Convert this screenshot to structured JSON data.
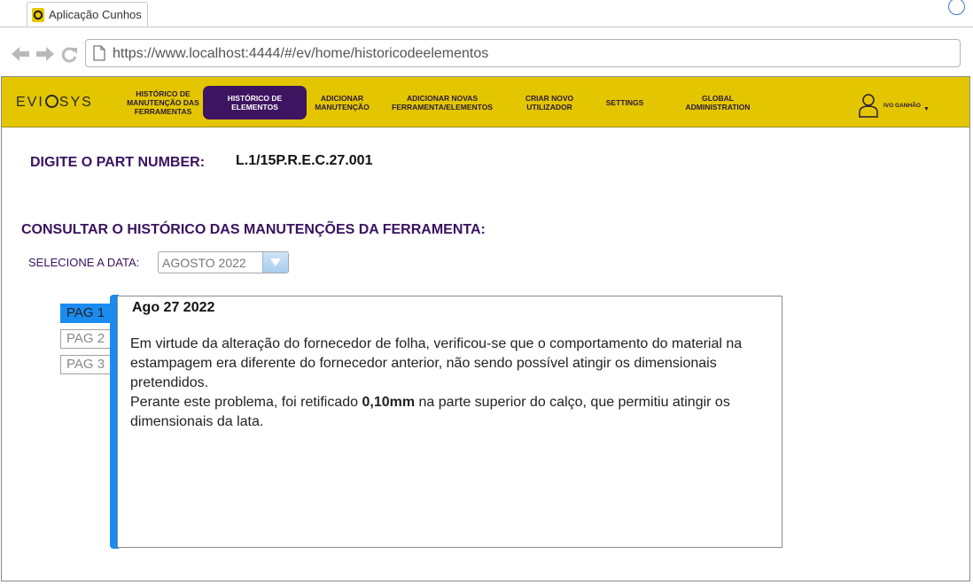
{
  "browser": {
    "tab_title": "Aplicação Cunhos",
    "url": "https://www.localhost:4444/#/ev/home/historicodeelementos"
  },
  "header": {
    "logo": {
      "prefix": "EVI",
      "suffix": "SYS"
    },
    "menu": [
      {
        "lines": [
          "HISTÓRICO DE",
          "MANUTENÇÃO DAS",
          "FERRAMENTAS"
        ],
        "active": false
      },
      {
        "lines": [
          "HISTÓRICO DE",
          "ELEMENTOS"
        ],
        "active": true
      },
      {
        "lines": [
          "ADICIONAR",
          "MANUTENÇÃO"
        ],
        "active": false
      },
      {
        "lines": [
          "ADICIONAR NOVAS",
          "FERRAMENTA/ELEMENTOS"
        ],
        "active": false
      },
      {
        "lines": [
          "CRIAR NOVO",
          "UTILIZADOR"
        ],
        "active": false
      },
      {
        "lines": [
          "SETTINGS"
        ],
        "active": false
      },
      {
        "lines": [
          "GLOBAL",
          "ADMINISTRATION"
        ],
        "active": false
      }
    ],
    "user_name": "IVO GANHÃO"
  },
  "part_number": {
    "label": "DIGITE O PART NUMBER:",
    "value": "L.1/15P.R.E.C.27.001"
  },
  "history": {
    "title": "CONSULTAR O HISTÓRICO DAS MANUTENÇÕES  DA FERRAMENTA:",
    "date_label": "SELECIONE A DATA:",
    "date_selected": "AGOSTO 2022",
    "pages": [
      {
        "label": "PAG 1",
        "active": true
      },
      {
        "label": "PAG 2",
        "active": false
      },
      {
        "label": "PAG 3",
        "active": false
      }
    ],
    "note": {
      "date": "Ago 27 2022",
      "paragraph1": "Em virtude da alteração do fornecedor de folha, verificou-se que o comportamento do material na estampagem era diferente do fornecedor anterior, não sendo possível atingir os dimensionais pretendidos.",
      "paragraph2_before": "Perante este problema, foi retificado ",
      "paragraph2_bold": "0,10mm",
      "paragraph2_after": " na parte superior do calço, que permitiu atingir os dimensionais da lata."
    }
  },
  "colors": {
    "header_bg": "#e3c600",
    "active_menu": "#3d1460",
    "title_purple": "#3a1260",
    "accent_blue": "#1a8cf0"
  }
}
